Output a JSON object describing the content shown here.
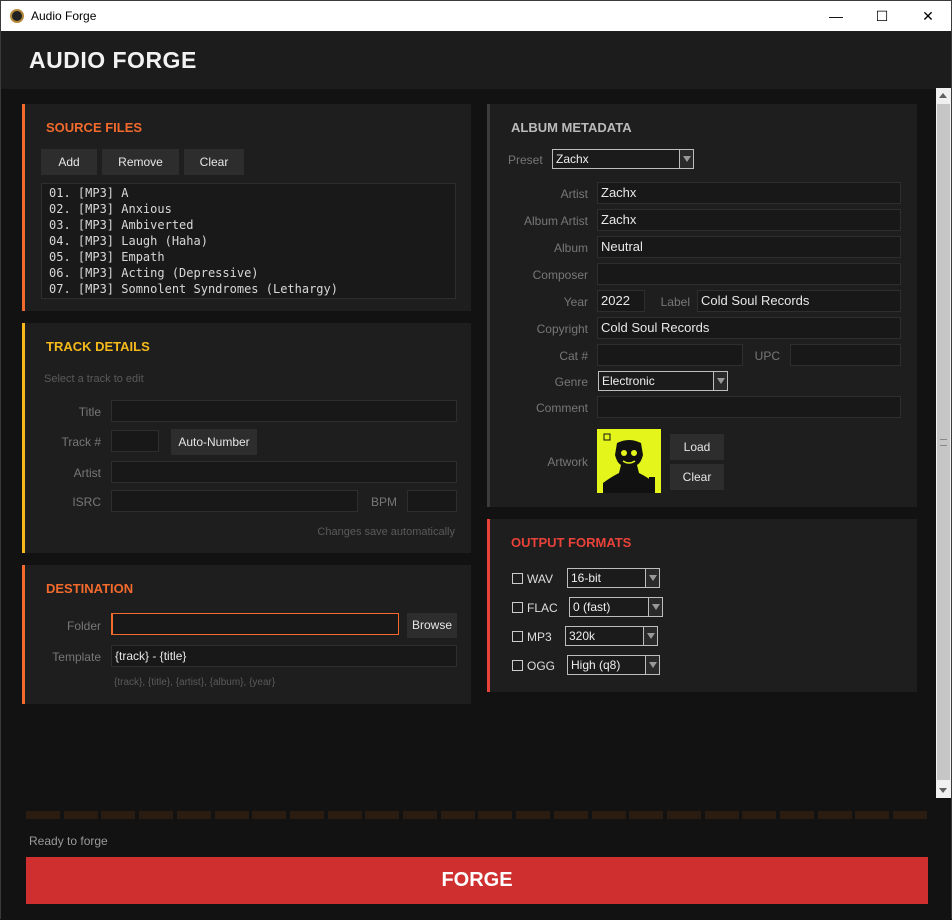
{
  "window": {
    "title": "Audio Forge",
    "minimize": "—",
    "maximize": "☐",
    "close": "✕"
  },
  "app": {
    "title": "AUDIO FORGE"
  },
  "source_files": {
    "heading": "SOURCE FILES",
    "add": "Add",
    "remove": "Remove",
    "clear": "Clear",
    "tracks": [
      "01. [MP3] A",
      "02. [MP3] Anxious",
      "03. [MP3] Ambiverted",
      "04. [MP3] Laugh (Haha)",
      "05. [MP3] Empath",
      "06. [MP3] Acting (Depressive)",
      "07. [MP3] Somnolent Syndromes (Lethargy)"
    ]
  },
  "track_details": {
    "heading": "TRACK DETAILS",
    "hint": "Select a track to edit",
    "title_label": "Title",
    "title_value": "",
    "track_label": "Track #",
    "track_value": "",
    "auto_number": "Auto-Number",
    "artist_label": "Artist",
    "artist_value": "",
    "isrc_label": "ISRC",
    "isrc_value": "",
    "bpm_label": "BPM",
    "bpm_value": "",
    "note": "Changes save automatically"
  },
  "destination": {
    "heading": "DESTINATION",
    "folder_label": "Folder",
    "folder_value": "",
    "browse": "Browse",
    "template_label": "Template",
    "template_value": "{track} - {title}",
    "template_hint": "{track}, {title}, {artist}, {album}, {year}"
  },
  "album_metadata": {
    "heading": "ALBUM METADATA",
    "preset_label": "Preset",
    "preset_value": "Zachx",
    "artist_label": "Artist",
    "artist_value": "Zachx",
    "album_artist_label": "Album Artist",
    "album_artist_value": "Zachx",
    "album_label": "Album",
    "album_value": "Neutral",
    "composer_label": "Composer",
    "composer_value": "",
    "year_label": "Year",
    "year_value": "2022",
    "label_label": "Label",
    "label_value": "Cold Soul Records",
    "copyright_label": "Copyright",
    "copyright_value": "Cold Soul Records",
    "cat_label": "Cat #",
    "cat_value": "",
    "upc_label": "UPC",
    "upc_value": "",
    "genre_label": "Genre",
    "genre_value": "Electronic",
    "comment_label": "Comment",
    "comment_value": "",
    "artwork_label": "Artwork",
    "load": "Load",
    "clear": "Clear"
  },
  "output_formats": {
    "heading": "OUTPUT FORMATS",
    "formats": [
      {
        "name": "WAV",
        "option": "16-bit",
        "checked": false
      },
      {
        "name": "FLAC",
        "option": "0 (fast)",
        "checked": false
      },
      {
        "name": "MP3",
        "option": "320k",
        "checked": false
      },
      {
        "name": "OGG",
        "option": "High (q8)",
        "checked": false
      }
    ]
  },
  "status": {
    "text": "Ready to forge",
    "progress": 0
  },
  "forge_button": "FORGE",
  "colors": {
    "source_accent": "#f26a2c",
    "track_accent": "#f5b91c",
    "destination_accent": "#f26a2c",
    "output_accent": "#e8423a",
    "forge_bg": "#cf2f2f",
    "artwork_bg": "#e4f51b"
  }
}
